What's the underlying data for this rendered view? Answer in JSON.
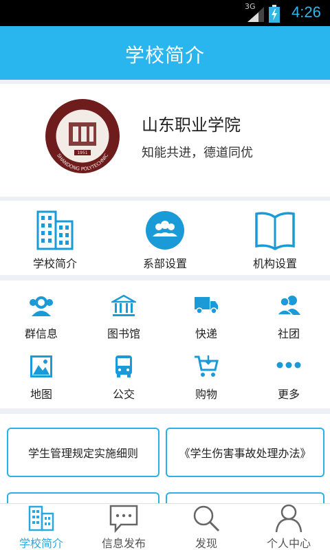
{
  "status_bar": {
    "network": "3G",
    "time": "4:26"
  },
  "header": {
    "title": "学校简介"
  },
  "school": {
    "name": "山东职业学院",
    "motto": "知能共进，德道同优",
    "seal_text": "SHANDONG POLYTECHNIC",
    "seal_year": "1951"
  },
  "main_menu": [
    {
      "label": "学校简介",
      "icon": "building-icon"
    },
    {
      "label": "系部设置",
      "icon": "people-circle-icon"
    },
    {
      "label": "机构设置",
      "icon": "book-icon"
    }
  ],
  "services": [
    {
      "label": "群信息",
      "icon": "group-icon"
    },
    {
      "label": "图书馆",
      "icon": "library-icon"
    },
    {
      "label": "快递",
      "icon": "truck-icon"
    },
    {
      "label": "社团",
      "icon": "club-icon"
    },
    {
      "label": "地图",
      "icon": "map-icon"
    },
    {
      "label": "公交",
      "icon": "bus-icon"
    },
    {
      "label": "购物",
      "icon": "cart-icon"
    },
    {
      "label": "更多",
      "icon": "more-icon"
    }
  ],
  "links": [
    {
      "label": "学生管理规定实施细则"
    },
    {
      "label": "《学生伤害事故处理办法》"
    }
  ],
  "bottom_nav": [
    {
      "label": "学校简介",
      "icon": "building-icon",
      "active": true
    },
    {
      "label": "信息发布",
      "icon": "chat-icon",
      "active": false
    },
    {
      "label": "发现",
      "icon": "search-icon",
      "active": false
    },
    {
      "label": "个人中心",
      "icon": "person-icon",
      "active": false
    }
  ],
  "colors": {
    "accent": "#29b6ee",
    "icon_blue": "#1a9ad6",
    "background": "#eef0f7",
    "status_time": "#33b5e5"
  }
}
